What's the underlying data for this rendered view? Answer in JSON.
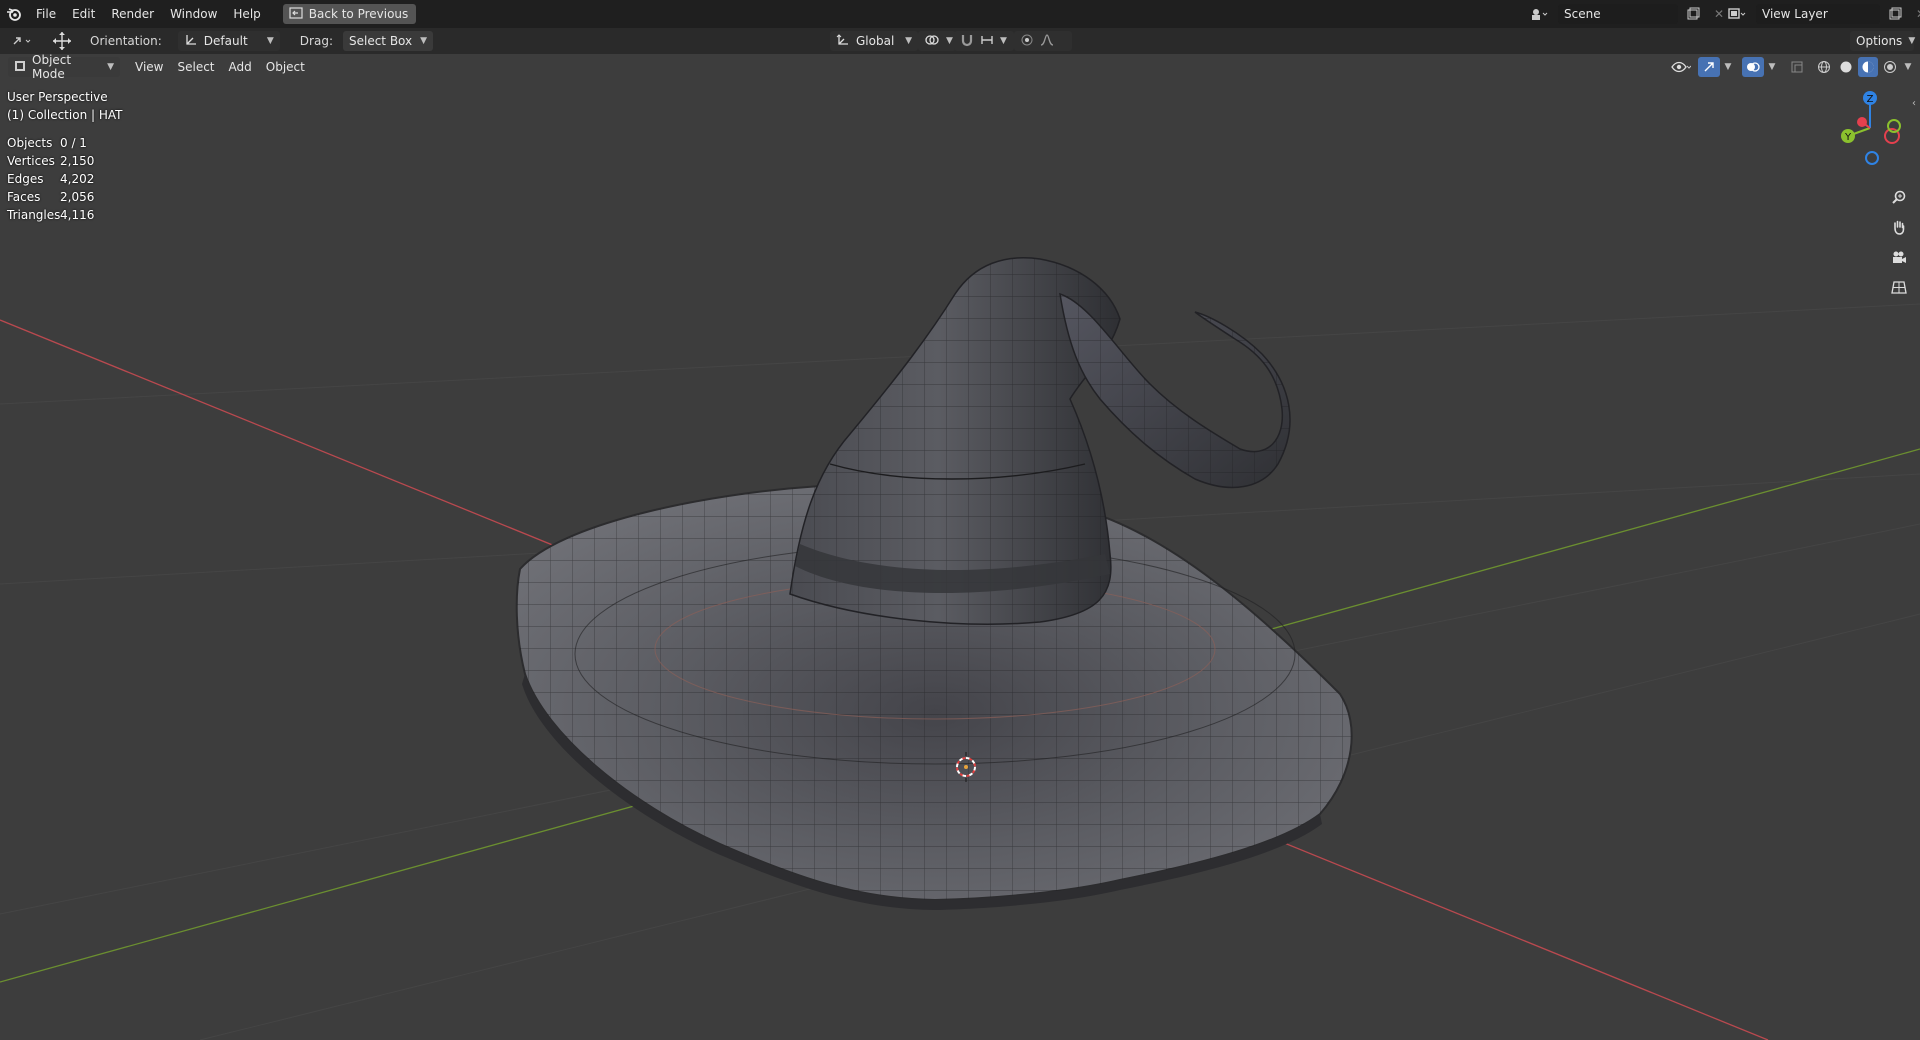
{
  "menubar": {
    "items": [
      "File",
      "Edit",
      "Render",
      "Window",
      "Help"
    ],
    "back_button": "Back to Previous",
    "scene": "Scene",
    "view_layer": "View Layer"
  },
  "toolheader": {
    "orientation_label": "Orientation:",
    "orientation_value": "Default",
    "drag_label": "Drag:",
    "drag_value": "Select Box",
    "transform_orientation": "Global",
    "options": "Options"
  },
  "viewheader": {
    "mode": "Object Mode",
    "menus": [
      "View",
      "Select",
      "Add",
      "Object"
    ]
  },
  "viewport": {
    "perspective": "User Perspective",
    "collection": "(1) Collection | HAT",
    "stats": [
      {
        "label": "Objects",
        "value": "0 / 1"
      },
      {
        "label": "Vertices",
        "value": "2,150"
      },
      {
        "label": "Edges",
        "value": "4,202"
      },
      {
        "label": "Faces",
        "value": "2,056"
      },
      {
        "label": "Triangles",
        "value": "4,116"
      }
    ],
    "gizmo": {
      "z": "Z",
      "y": "Y"
    }
  },
  "colors": {
    "x_axis": "#b9494f",
    "y_axis": "#6b8f30",
    "z_gizmo": "#2f83e4",
    "y_gizmo": "#8bc12e",
    "x_gizmo": "#e4404e"
  }
}
